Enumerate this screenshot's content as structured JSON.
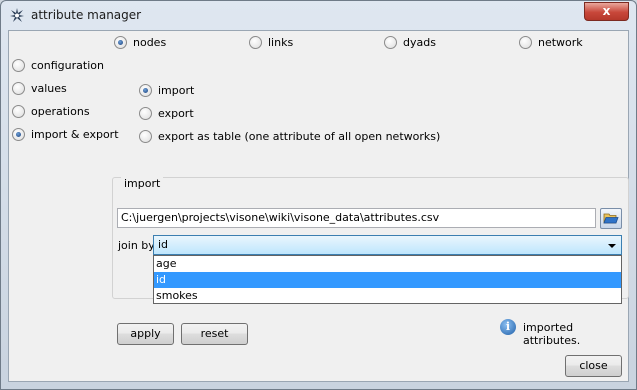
{
  "window": {
    "title": "attribute manager",
    "close_glyph": "x"
  },
  "scope": [
    {
      "label": "nodes",
      "selected": true
    },
    {
      "label": "links",
      "selected": false
    },
    {
      "label": "dyads",
      "selected": false
    },
    {
      "label": "network",
      "selected": false
    }
  ],
  "sections": [
    {
      "label": "configuration",
      "selected": false
    },
    {
      "label": "values",
      "selected": false
    },
    {
      "label": "operations",
      "selected": false
    },
    {
      "label": "import & export",
      "selected": true
    }
  ],
  "modes": [
    {
      "label": "import",
      "selected": true
    },
    {
      "label": "export",
      "selected": false
    },
    {
      "label": "export as table (one attribute of all open networks)",
      "selected": false
    }
  ],
  "import_group": {
    "title": "import",
    "path": "C:\\juergen\\projects\\visone\\wiki\\visone_data\\attributes.csv",
    "browse_icon": "folder-open-icon",
    "join_by_label": "join by",
    "join_by_value": "id",
    "options": [
      "age",
      "id",
      "smokes"
    ],
    "highlighted_option": "id"
  },
  "buttons": {
    "apply": "apply",
    "reset": "reset",
    "close": "close"
  },
  "status": {
    "icon": "info-icon",
    "text": "imported attributes."
  },
  "colors": {
    "selection": "#3399ff",
    "close_red": "#c8473a"
  }
}
